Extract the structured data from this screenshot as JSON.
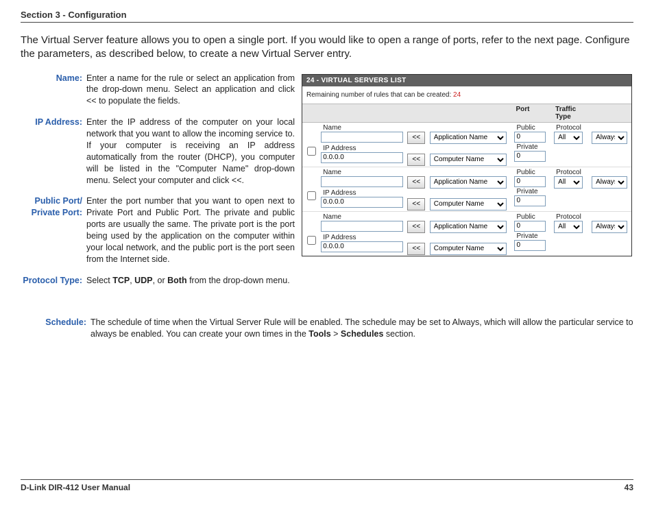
{
  "header": "Section 3 - Configuration",
  "intro": "The Virtual Server feature allows you to open a single port. If you would like to open a range of ports, refer to the next page. Configure the parameters, as described below, to create a new Virtual Server entry.",
  "defs": {
    "name": {
      "label": "Name:",
      "body": "Enter a name for the rule or select an application from the drop-down menu. Select an application and click << to populate the fields."
    },
    "ip": {
      "label": "IP Address:",
      "body": "Enter the IP address of the computer on your local network that you want to allow the incoming service to. If your computer is receiving an IP address automatically from the router (DHCP), you computer will be listed in the \"Computer Name\" drop-down menu. Select your computer and click <<."
    },
    "ports": {
      "label1": "Public Port/",
      "label2": "Private Port:",
      "body": "Enter the port number that you want to open next to Private Port and Public Port. The private and public ports are usually the same. The private port is the port being used by the application on the computer within your local network, and the public port is the port seen from the Internet side."
    },
    "protocol": {
      "label": "Protocol Type:",
      "body_pre": "Select ",
      "tcp": "TCP",
      "sep1": ", ",
      "udp": "UDP",
      "sep2": ", or ",
      "both": "Both",
      "body_post": " from the drop-down menu."
    },
    "schedule": {
      "label": "Schedule:",
      "body_pre": "The schedule of time when the Virtual Server Rule will be enabled. The schedule may be set to Always, which will allow the particular service to always be enabled. You can create your own times in the ",
      "tools": "Tools",
      "gt": " > ",
      "schedules": "Schedules",
      "body_post": " section."
    }
  },
  "panel": {
    "title": "24 - VIRTUAL SERVERS LIST",
    "remaining_label": "Remaining number of rules that can be created: ",
    "remaining_value": "24",
    "hdr_port": "Port",
    "hdr_traffic": "Traffic Type",
    "lbl_name": "Name",
    "lbl_ip": "IP Address",
    "lbl_public": "Public",
    "lbl_private": "Private",
    "lbl_protocol": "Protocol",
    "btn_push": "<<",
    "opt_app": "Application Name",
    "opt_comp": "Computer Name",
    "opt_proto": "All",
    "opt_sched": "Always",
    "val_ip": "0.0.0.0",
    "val_port": "0"
  },
  "footer": {
    "left": "D-Link DIR-412 User Manual",
    "right": "43"
  }
}
